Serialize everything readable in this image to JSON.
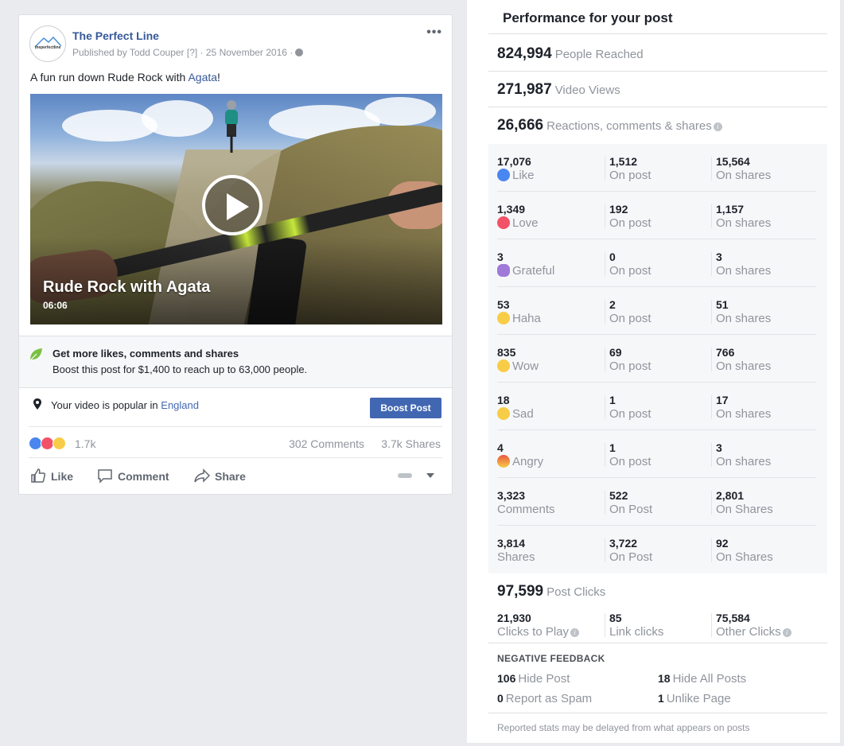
{
  "post": {
    "page_name": "The Perfect Line",
    "avatar_logo_text": "theperfectline",
    "meta": "Published by Todd Couper [?] · 25 November 2016 ·",
    "more_icon": "more-icon",
    "text_before_link": "A fun run down Rude Rock with ",
    "text_link": "Agata",
    "text_after_link": "!",
    "video": {
      "title": "Rude Rock with Agata",
      "duration": "06:06",
      "play_icon": "play-icon"
    },
    "boost_tip": {
      "title": "Get more likes, comments and shares",
      "description": "Boost this post for $1,400 to reach up to 63,000 people.",
      "icon": "leaf-icon"
    },
    "popular": {
      "text": "Your video is popular in ",
      "location_link": "England",
      "icon": "location-pin-icon"
    },
    "boost_button": "Boost Post",
    "stats": {
      "reactions_count": "1.7k",
      "comments": "302 Comments",
      "shares": "3.7k Shares"
    },
    "actions": {
      "like": "Like",
      "comment": "Comment",
      "share": "Share"
    }
  },
  "insights": {
    "title": "Performance for your post",
    "people_reached": {
      "value": "824,994",
      "label": "People Reached"
    },
    "video_views": {
      "value": "271,987",
      "label": "Video Views"
    },
    "engagement": {
      "value": "26,666",
      "label": "Reactions, comments & shares"
    },
    "breakdown": [
      {
        "total": "17,076",
        "label": "Like",
        "icon": "like-icon",
        "on_post": "1,512",
        "on_post_label": "On post",
        "on_shares": "15,564",
        "on_shares_label": "On shares"
      },
      {
        "total": "1,349",
        "label": "Love",
        "icon": "love-icon",
        "on_post": "192",
        "on_post_label": "On post",
        "on_shares": "1,157",
        "on_shares_label": "On shares"
      },
      {
        "total": "3",
        "label": "Grateful",
        "icon": "grateful-icon",
        "on_post": "0",
        "on_post_label": "On post",
        "on_shares": "3",
        "on_shares_label": "On shares"
      },
      {
        "total": "53",
        "label": "Haha",
        "icon": "haha-icon",
        "on_post": "2",
        "on_post_label": "On post",
        "on_shares": "51",
        "on_shares_label": "On shares"
      },
      {
        "total": "835",
        "label": "Wow",
        "icon": "wow-icon",
        "on_post": "69",
        "on_post_label": "On post",
        "on_shares": "766",
        "on_shares_label": "On shares"
      },
      {
        "total": "18",
        "label": "Sad",
        "icon": "sad-icon",
        "on_post": "1",
        "on_post_label": "On post",
        "on_shares": "17",
        "on_shares_label": "On shares"
      },
      {
        "total": "4",
        "label": "Angry",
        "icon": "angry-icon",
        "on_post": "1",
        "on_post_label": "On post",
        "on_shares": "3",
        "on_shares_label": "On shares"
      },
      {
        "total": "3,323",
        "label": "Comments",
        "icon": "",
        "on_post": "522",
        "on_post_label": "On Post",
        "on_shares": "2,801",
        "on_shares_label": "On Shares"
      },
      {
        "total": "3,814",
        "label": "Shares",
        "icon": "",
        "on_post": "3,722",
        "on_post_label": "On Post",
        "on_shares": "92",
        "on_shares_label": "On Shares"
      }
    ],
    "post_clicks": {
      "value": "97,599",
      "label": "Post Clicks"
    },
    "clicks_breakdown": [
      {
        "value": "21,930",
        "label": "Clicks to Play"
      },
      {
        "value": "85",
        "label": "Link clicks"
      },
      {
        "value": "75,584",
        "label": "Other Clicks"
      }
    ],
    "negative_feedback": {
      "heading": "NEGATIVE FEEDBACK",
      "hide_post": {
        "value": "106",
        "label": "Hide Post"
      },
      "hide_all_posts": {
        "value": "18",
        "label": "Hide All Posts"
      },
      "report_spam": {
        "value": "0",
        "label": "Report as Spam"
      },
      "unlike_page": {
        "value": "1",
        "label": "Unlike Page"
      }
    },
    "footnote": "Reported stats may be delayed from what appears on posts"
  },
  "colors": {
    "background": "#e9ebee",
    "link": "#365899",
    "boost_button": "#4267b2",
    "muted_text": "#90949c"
  }
}
